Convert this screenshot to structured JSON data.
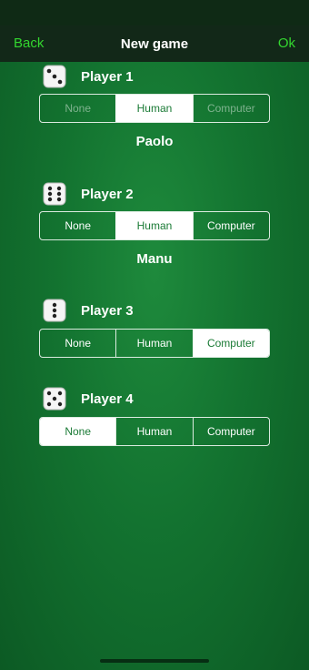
{
  "nav": {
    "back_label": "Back",
    "title": "New game",
    "ok_label": "Ok"
  },
  "options": [
    "None",
    "Human",
    "Computer"
  ],
  "players": [
    {
      "label": "Player 1",
      "selected": "Human",
      "name": "Paolo"
    },
    {
      "label": "Player 2",
      "selected": "Human",
      "name": "Manu"
    },
    {
      "label": "Player 3",
      "selected": "Computer"
    },
    {
      "label": "Player 4",
      "selected": "None"
    }
  ],
  "colors": {
    "accent": "#33d62f",
    "table_green": "#137330",
    "selected_text": "#1a7a35"
  }
}
